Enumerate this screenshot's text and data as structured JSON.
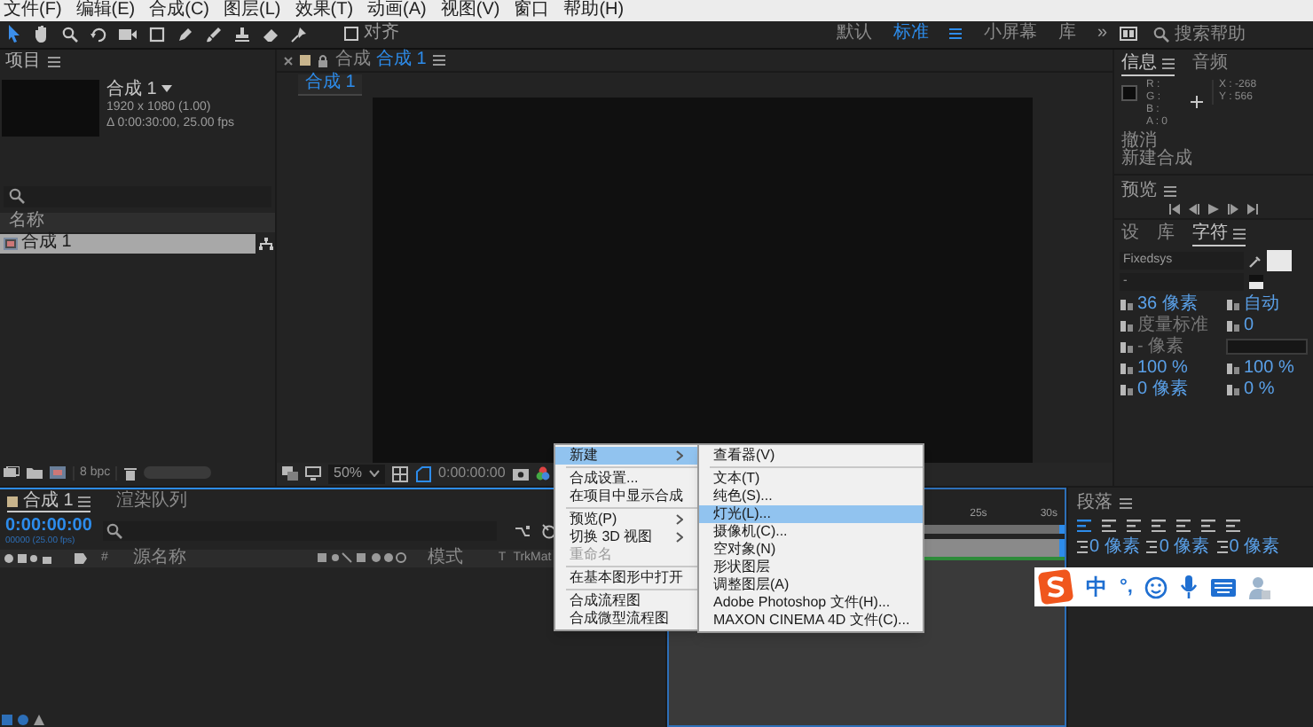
{
  "menu_bar": [
    "文件(F)",
    "编辑(E)",
    "合成(C)",
    "图层(L)",
    "效果(T)",
    "动画(A)",
    "视图(V)",
    "窗口",
    "帮助(H)"
  ],
  "toolbar": {
    "snap_label": "对齐",
    "snap_checked": false
  },
  "workspaces": [
    {
      "label": "默认",
      "selected": false
    },
    {
      "label": "标准",
      "selected": true
    },
    {
      "label": "小屏幕",
      "selected": false
    },
    {
      "label": "库",
      "selected": false
    }
  ],
  "workspace_overflow": "»",
  "help_search": {
    "placeholder": "搜索帮助"
  },
  "project": {
    "title": "项目",
    "comp_name": "合成 1",
    "comp_size": "1920 x 1080 (1.00)",
    "comp_duration": "Δ 0:00:30:00, 25.00 fps",
    "column": "名称",
    "items": [
      {
        "name": "合成 1",
        "selected": true
      }
    ],
    "bit_depth": "8 bpc"
  },
  "viewer": {
    "tab_prefix": "合成",
    "tab_name": "合成 1",
    "breadcrumb": "合成 1",
    "zoom": "50%",
    "timecode": "0:00:00:00"
  },
  "info": {
    "tabs": [
      {
        "label": "信息",
        "selected": true
      },
      {
        "label": "音频",
        "selected": false
      }
    ],
    "channels": [
      "R :",
      "G :",
      "B :",
      "A : 0"
    ],
    "coords": [
      "X : -268",
      "Y : 566"
    ],
    "history": [
      "撤消",
      "新建合成"
    ]
  },
  "preview": {
    "title": "预览"
  },
  "character": {
    "tabs": [
      {
        "label": "设",
        "selected": false
      },
      {
        "label": "库",
        "selected": false
      },
      {
        "label": "字符",
        "selected": true
      }
    ],
    "font": "Fixedsys",
    "style": "-",
    "size": "36 像素",
    "leading": "自动",
    "kerning": "度量标准",
    "tracking": "0",
    "stroke": "- 像素",
    "vertical_scale": "100 %",
    "horizontal_scale": "100 %",
    "baseline": "0 像素",
    "tsume": "0 %"
  },
  "paragraph": {
    "title": "段落",
    "align_buttons": [
      {
        "selected": true
      },
      {
        "selected": false
      },
      {
        "selected": false
      },
      {
        "selected": false
      },
      {
        "selected": false
      },
      {
        "selected": false
      },
      {
        "selected": false
      }
    ],
    "indents": [
      "0 像素",
      "0 像素",
      "0 像素"
    ]
  },
  "timeline": {
    "tabs": [
      {
        "label": "合成 1",
        "selected": true
      },
      {
        "label": "渲染队列",
        "selected": false
      }
    ],
    "timecode": "0:00:00:00",
    "frame_info": "00000 (25.00 fps)",
    "columns": [
      "#",
      "源名称",
      "模式",
      "T",
      "TrkMat"
    ],
    "ruler": [
      "25s",
      "30s"
    ]
  },
  "context_menu": [
    {
      "kind": "item",
      "label": "新建",
      "submenu": true,
      "selected": true,
      "disabled": false
    },
    {
      "kind": "separator"
    },
    {
      "kind": "item",
      "label": "合成设置...",
      "submenu": false,
      "selected": false,
      "disabled": false
    },
    {
      "kind": "item",
      "label": "在项目中显示合成",
      "submenu": false,
      "selected": false,
      "disabled": false
    },
    {
      "kind": "separator"
    },
    {
      "kind": "item",
      "label": "预览(P)",
      "submenu": true,
      "selected": false,
      "disabled": false
    },
    {
      "kind": "item",
      "label": "切换 3D 视图",
      "submenu": true,
      "selected": false,
      "disabled": false
    },
    {
      "kind": "item",
      "label": "重命名",
      "submenu": false,
      "selected": false,
      "disabled": true
    },
    {
      "kind": "separator"
    },
    {
      "kind": "item",
      "label": "在基本图形中打开",
      "submenu": false,
      "selected": false,
      "disabled": false
    },
    {
      "kind": "separator"
    },
    {
      "kind": "item",
      "label": "合成流程图",
      "submenu": false,
      "selected": false,
      "disabled": false
    },
    {
      "kind": "item",
      "label": "合成微型流程图",
      "submenu": false,
      "selected": false,
      "disabled": false
    }
  ],
  "submenu": [
    {
      "kind": "item",
      "label": "查看器(V)",
      "selected": false
    },
    {
      "kind": "separator"
    },
    {
      "kind": "item",
      "label": "文本(T)",
      "selected": false
    },
    {
      "kind": "item",
      "label": "纯色(S)...",
      "selected": false
    },
    {
      "kind": "item",
      "label": "灯光(L)...",
      "selected": true
    },
    {
      "kind": "item",
      "label": "摄像机(C)...",
      "selected": false
    },
    {
      "kind": "item",
      "label": "空对象(N)",
      "selected": false
    },
    {
      "kind": "item",
      "label": "形状图层",
      "selected": false
    },
    {
      "kind": "item",
      "label": "调整图层(A)",
      "selected": false
    },
    {
      "kind": "item",
      "label": "Adobe Photoshop 文件(H)...",
      "selected": false
    },
    {
      "kind": "item",
      "label": "MAXON CINEMA 4D 文件(C)...",
      "selected": false
    }
  ],
  "ime": {
    "mode": "中",
    "punctuation": "°,"
  }
}
